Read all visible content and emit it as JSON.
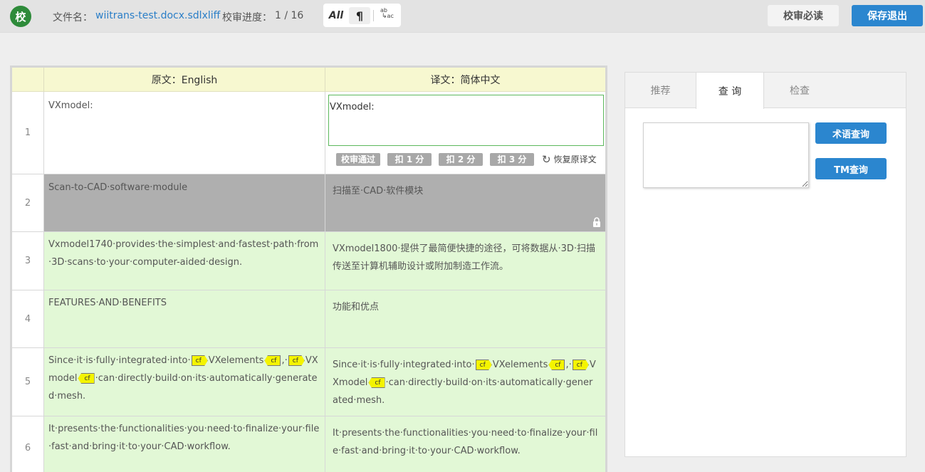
{
  "header": {
    "logo_text": "校",
    "file_label": "文件名：",
    "file_name": "wiitrans-test.docx.sdlxliff",
    "progress_label": "校审进度：",
    "progress_value": "1 / 16",
    "tool_all": "All",
    "tool_para": "¶",
    "tool_abc_top": "ab",
    "tool_abc_bottom": "ac",
    "read_button": "校审必读",
    "save_button": "保存退出"
  },
  "grid": {
    "header_source": "原文：English",
    "header_target": "译文：简体中文",
    "rows": [
      {
        "num": "1",
        "source": "VXmodel:",
        "target": "VXmodel:"
      },
      {
        "num": "2",
        "source": "Scan-to-CAD·software·module",
        "target": "扫描至·CAD·软件模块"
      },
      {
        "num": "3",
        "source": "Vxmodel1740·provides·the·simplest·and·fastest·path·from·3D·scans·to·your·computer-aided·design.",
        "target": "VXmodel1800·提供了最简便快捷的途径，可将数据从·3D·扫描传送至计算机辅助设计或附加制造工作流。"
      },
      {
        "num": "4",
        "source": "FEATURES·AND·BENEFITS",
        "target": "功能和优点"
      },
      {
        "num": "5",
        "source_p1": "Since·it·is·fully·integrated·into·",
        "source_p2": "VXelements",
        "source_p3": ",·",
        "source_p4": "VXmodel",
        "source_p5": "·can·directly·build·on·its·automatically·generated·mesh.",
        "target_p1": "Since·it·is·fully·integrated·into·",
        "target_p2": "VXelements",
        "target_p3": ",·",
        "target_p4": "VXmodel",
        "target_p5": "·can·directly·build·on·its·automatically·generated·mesh."
      },
      {
        "num": "6",
        "source": "It·presents·the·functionalities·you·need·to·finalize·your·file·fast·and·bring·it·to·your·CAD·workflow.",
        "target": "It·presents·the·functionalities·you·need·to·finalize·your·file·fast·and·bring·it·to·your·CAD·workflow."
      }
    ],
    "tag_label": "cf",
    "actions": {
      "approve": "校审通过",
      "minus1": "扣 1 分",
      "minus2": "扣 2 分",
      "minus3": "扣 3 分",
      "restore": "恢复原译文"
    }
  },
  "panel": {
    "tabs": [
      "推荐",
      "查 询",
      "检查"
    ],
    "active_tab": "查 询",
    "term_button": "术语查询",
    "tm_button": "TM查询"
  },
  "colors": {
    "brand_green": "#2e8b3a",
    "accent_blue": "#2b86cf",
    "row_green": "#e2f8d6",
    "row_locked": "#afafaf",
    "header_yellow": "#f7f8d0",
    "tag_yellow": "#f4f400"
  }
}
